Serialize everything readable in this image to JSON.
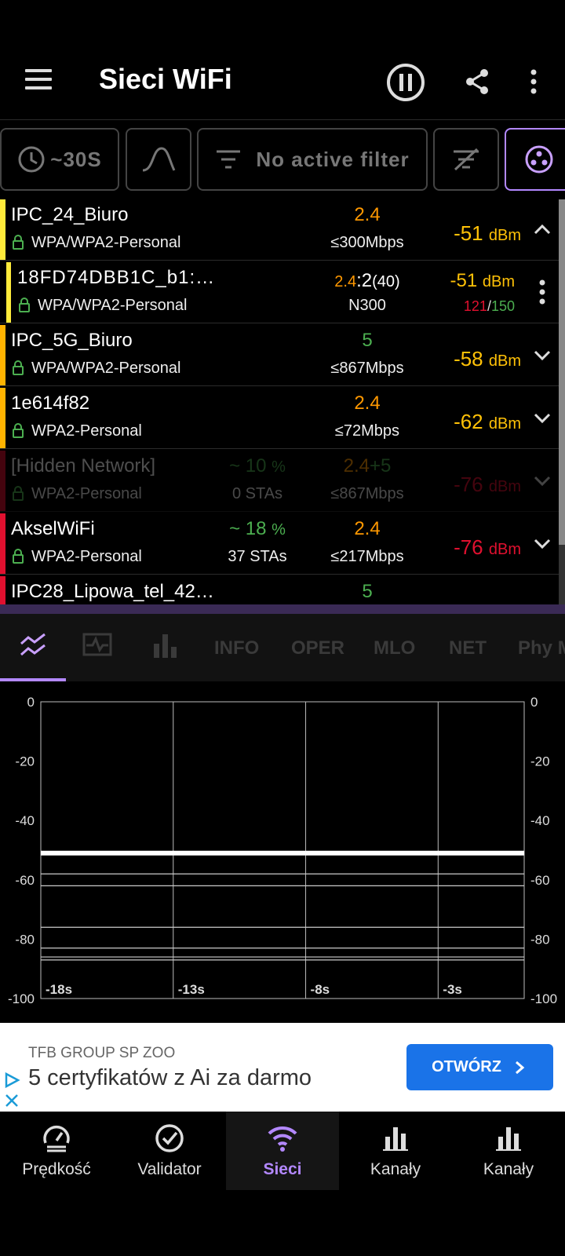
{
  "header": {
    "title": "Sieci WiFi"
  },
  "toolbar": {
    "interval": "~30S",
    "filter_label": "No active filter"
  },
  "networks": [
    {
      "ssid": "IPC_24_Biuro",
      "security": "WPA/WPA2-Personal",
      "band": "2.4",
      "rate": "≤300Mbps",
      "signal": "-51",
      "unit": "dBm",
      "stripe": "#ffeb3b",
      "band_color": "#ff9800",
      "signal_color": "#ffc107"
    },
    {
      "ssid": "18FD74DBB1C_b1:…",
      "security": "WPA/WPA2-Personal",
      "band": "2.4",
      "channel": "2",
      "width": "(40)",
      "rate": "N300",
      "signal": "-51",
      "unit": "dBm",
      "rx": "121",
      "tx": "150",
      "stripe": "#ffeb3b",
      "signal_color": "#ffc107"
    },
    {
      "ssid": "IPC_5G_Biuro",
      "security": "WPA/WPA2-Personal",
      "band": "5",
      "rate": "≤867Mbps",
      "signal": "-58",
      "unit": "dBm",
      "stripe": "#ffb300",
      "band_color": "#4caf50",
      "signal_color": "#ffc107"
    },
    {
      "ssid": "1e614f82",
      "security": "WPA2-Personal",
      "band": "2.4",
      "rate": "≤72Mbps",
      "signal": "-62",
      "unit": "dBm",
      "stripe": "#ffb300",
      "band_color": "#ff9800",
      "signal_color": "#ffc107"
    },
    {
      "ssid": "[Hidden Network]",
      "security": "WPA2-Personal",
      "util": "~ 10",
      "util_unit": "%",
      "stations": "0 STAs",
      "band": "2.4",
      "band2": "+5",
      "rate": "≤867Mbps",
      "signal": "-76",
      "unit": "dBm",
      "stripe": "#5a0a0a"
    },
    {
      "ssid": "AkselWiFi",
      "security": "WPA2-Personal",
      "util": "~ 18",
      "util_unit": "%",
      "stations": "37 STAs",
      "band": "2.4",
      "rate": "≤217Mbps",
      "signal": "-76",
      "unit": "dBm",
      "stripe": "#e0102f",
      "band_color": "#ff9800",
      "signal_color": "#e0102f"
    },
    {
      "ssid": "IPC28_Lipowa_tel_42…",
      "band": "5",
      "stripe": "#e0102f",
      "band_color": "#4caf50"
    }
  ],
  "tabs": [
    "INFO",
    "OPER",
    "MLO",
    "NET",
    "Phy M"
  ],
  "chart_data": {
    "type": "line",
    "y_ticks": [
      "0",
      "-20",
      "-40",
      "-60",
      "-80",
      "-100"
    ],
    "x_ticks": [
      "-18s",
      "-13s",
      "-8s",
      "-3s"
    ],
    "ylim": [
      -100,
      0
    ],
    "series": [
      {
        "values": [
          -51,
          -51
        ],
        "highlight": true
      },
      {
        "values": [
          -58,
          -58
        ]
      },
      {
        "values": [
          -62,
          -62
        ]
      },
      {
        "values": [
          -76,
          -76
        ]
      },
      {
        "values": [
          -83,
          -83
        ]
      },
      {
        "values": [
          -86,
          -86
        ]
      },
      {
        "values": [
          -87,
          -87
        ]
      }
    ],
    "grid": true
  },
  "ad": {
    "advertiser": "TFB GROUP SP ZOO",
    "headline": "5 certyfikatów z Ai za darmo",
    "cta": "OTWÓRZ"
  },
  "bottom_nav": [
    {
      "label": "Prędkość",
      "icon": "speedometer-icon"
    },
    {
      "label": "Validator",
      "icon": "check-circle-icon"
    },
    {
      "label": "Sieci",
      "icon": "wifi-icon",
      "active": true
    },
    {
      "label": "Kanały",
      "icon": "bar-chart-icon"
    },
    {
      "label": "Kanały",
      "icon": "bar-chart-icon"
    }
  ],
  "colors": {
    "accent": "#b388ff",
    "active_tab_bg": "#151515"
  }
}
